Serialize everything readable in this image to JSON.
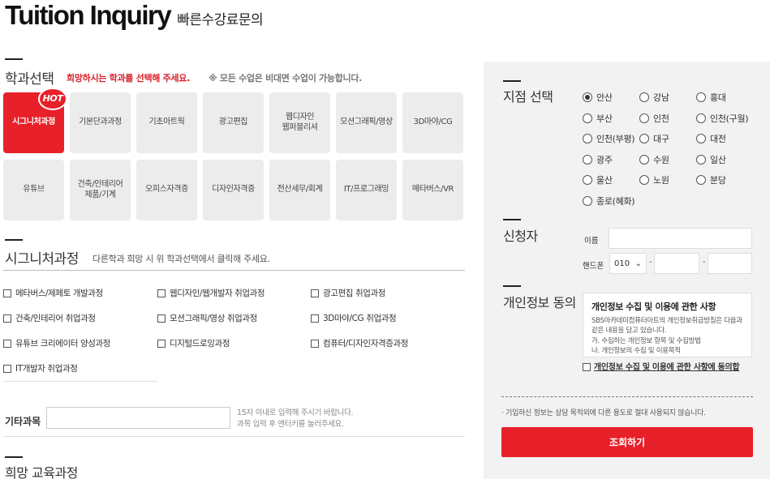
{
  "header": {
    "title": "Tuition Inquiry",
    "subtitle": "빠른수강료문의"
  },
  "department": {
    "section_title": "학과선택",
    "hint_required": "희망하시는 학과를 선택해 주세요.",
    "hint_note": "※ 모든 수업은 비대면 수업이 가능합니다.",
    "hot_badge": "HOT",
    "tiles": [
      [
        "시그니처과정"
      ],
      [
        "기본단과과정"
      ],
      [
        "기초아트웍"
      ],
      [
        "광고편집"
      ],
      [
        "웹디자인",
        "웹퍼블리셔"
      ],
      [
        "모션그래픽/영상"
      ],
      [
        "3D마야/CG"
      ],
      [
        "유튜브"
      ],
      [
        "건축/인테리어",
        "제품/기계"
      ],
      [
        "오피스자격증"
      ],
      [
        "디자인자격증"
      ],
      [
        "전산세무/회계"
      ],
      [
        "IT/프로그래밍"
      ],
      [
        "메타버스/VR"
      ]
    ],
    "active_index": 0
  },
  "signature": {
    "section_title": "시그니처과정",
    "hint": "다른학과 희망 시 위 학과선택에서 클릭해 주세요.",
    "courses": [
      "메타버스/제페토 개발과정",
      "웹디자인/웹개발자 취업과정",
      "광고편집 취업과정",
      "건축/인테리어 취업과정",
      "모션그래픽/영상 취업과정",
      "3D마야/CG 취업과정",
      "유튜브 크리에이터 양성과정",
      "디지털드로잉과정",
      "컴퓨터/디자인자격증과정",
      "IT개발자 취업과정"
    ],
    "etc_label": "기타과목",
    "etc_hint_1": "15자 이내로 입력해 주시기 바랍니다.",
    "etc_hint_2": "과목 입력 후 엔터키를 눌러주세요."
  },
  "wish_course": {
    "section_title": "희망 교육과정"
  },
  "branch": {
    "section_title": "지점 선택",
    "options": [
      "안산",
      "강남",
      "홍대",
      "부산",
      "인천",
      "인천(구월)",
      "인천(부평)",
      "대구",
      "대전",
      "광주",
      "수원",
      "일산",
      "울산",
      "노원",
      "분당",
      "종로(혜화)"
    ],
    "selected": "안산"
  },
  "applicant": {
    "section_title": "신청자",
    "name_label": "이름",
    "phone_label": "핸드폰",
    "phone_prefix": "010",
    "dash": "-"
  },
  "privacy": {
    "section_title": "개인정보 동의",
    "box_title": "개인정보 수집 및 이용에 관한 사항",
    "box_text_1": "SBS아카데미컴퓨터아트의 개인정보취급방침은 다음과 같은 내용을 담고 있습니다.",
    "box_text_2": "가. 수집하는 개인정보 항목 및 수집방법",
    "box_text_3": "나. 개인정보의 수집 및 이용목적",
    "agree_label": "개인정보 수집 및 이용에 관한 사항에 동의합",
    "notice": "· 기입하신 정보는 상담 목적외에 다른 용도로 절대 사용되지 않습니다.",
    "submit_label": "조회하기"
  },
  "colors": {
    "accent": "#e8202a",
    "panel_bg": "#f2f2f2",
    "tile_bg": "#ececec"
  }
}
